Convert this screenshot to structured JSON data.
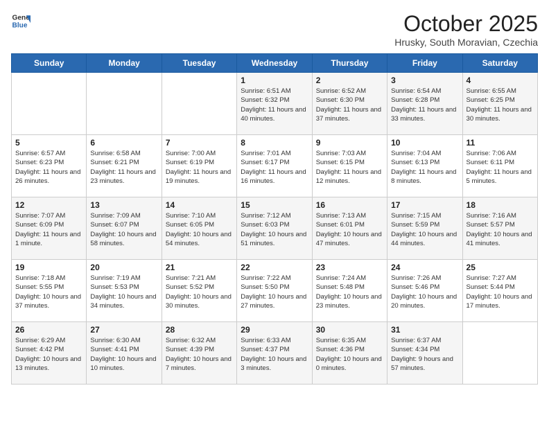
{
  "logo": {
    "line1": "General",
    "line2": "Blue"
  },
  "title": "October 2025",
  "subtitle": "Hrusky, South Moravian, Czechia",
  "weekdays": [
    "Sunday",
    "Monday",
    "Tuesday",
    "Wednesday",
    "Thursday",
    "Friday",
    "Saturday"
  ],
  "weeks": [
    [
      {
        "day": "",
        "sunrise": "",
        "sunset": "",
        "daylight": ""
      },
      {
        "day": "",
        "sunrise": "",
        "sunset": "",
        "daylight": ""
      },
      {
        "day": "",
        "sunrise": "",
        "sunset": "",
        "daylight": ""
      },
      {
        "day": "1",
        "sunrise": "Sunrise: 6:51 AM",
        "sunset": "Sunset: 6:32 PM",
        "daylight": "Daylight: 11 hours and 40 minutes."
      },
      {
        "day": "2",
        "sunrise": "Sunrise: 6:52 AM",
        "sunset": "Sunset: 6:30 PM",
        "daylight": "Daylight: 11 hours and 37 minutes."
      },
      {
        "day": "3",
        "sunrise": "Sunrise: 6:54 AM",
        "sunset": "Sunset: 6:28 PM",
        "daylight": "Daylight: 11 hours and 33 minutes."
      },
      {
        "day": "4",
        "sunrise": "Sunrise: 6:55 AM",
        "sunset": "Sunset: 6:25 PM",
        "daylight": "Daylight: 11 hours and 30 minutes."
      }
    ],
    [
      {
        "day": "5",
        "sunrise": "Sunrise: 6:57 AM",
        "sunset": "Sunset: 6:23 PM",
        "daylight": "Daylight: 11 hours and 26 minutes."
      },
      {
        "day": "6",
        "sunrise": "Sunrise: 6:58 AM",
        "sunset": "Sunset: 6:21 PM",
        "daylight": "Daylight: 11 hours and 23 minutes."
      },
      {
        "day": "7",
        "sunrise": "Sunrise: 7:00 AM",
        "sunset": "Sunset: 6:19 PM",
        "daylight": "Daylight: 11 hours and 19 minutes."
      },
      {
        "day": "8",
        "sunrise": "Sunrise: 7:01 AM",
        "sunset": "Sunset: 6:17 PM",
        "daylight": "Daylight: 11 hours and 16 minutes."
      },
      {
        "day": "9",
        "sunrise": "Sunrise: 7:03 AM",
        "sunset": "Sunset: 6:15 PM",
        "daylight": "Daylight: 11 hours and 12 minutes."
      },
      {
        "day": "10",
        "sunrise": "Sunrise: 7:04 AM",
        "sunset": "Sunset: 6:13 PM",
        "daylight": "Daylight: 11 hours and 8 minutes."
      },
      {
        "day": "11",
        "sunrise": "Sunrise: 7:06 AM",
        "sunset": "Sunset: 6:11 PM",
        "daylight": "Daylight: 11 hours and 5 minutes."
      }
    ],
    [
      {
        "day": "12",
        "sunrise": "Sunrise: 7:07 AM",
        "sunset": "Sunset: 6:09 PM",
        "daylight": "Daylight: 11 hours and 1 minute."
      },
      {
        "day": "13",
        "sunrise": "Sunrise: 7:09 AM",
        "sunset": "Sunset: 6:07 PM",
        "daylight": "Daylight: 10 hours and 58 minutes."
      },
      {
        "day": "14",
        "sunrise": "Sunrise: 7:10 AM",
        "sunset": "Sunset: 6:05 PM",
        "daylight": "Daylight: 10 hours and 54 minutes."
      },
      {
        "day": "15",
        "sunrise": "Sunrise: 7:12 AM",
        "sunset": "Sunset: 6:03 PM",
        "daylight": "Daylight: 10 hours and 51 minutes."
      },
      {
        "day": "16",
        "sunrise": "Sunrise: 7:13 AM",
        "sunset": "Sunset: 6:01 PM",
        "daylight": "Daylight: 10 hours and 47 minutes."
      },
      {
        "day": "17",
        "sunrise": "Sunrise: 7:15 AM",
        "sunset": "Sunset: 5:59 PM",
        "daylight": "Daylight: 10 hours and 44 minutes."
      },
      {
        "day": "18",
        "sunrise": "Sunrise: 7:16 AM",
        "sunset": "Sunset: 5:57 PM",
        "daylight": "Daylight: 10 hours and 41 minutes."
      }
    ],
    [
      {
        "day": "19",
        "sunrise": "Sunrise: 7:18 AM",
        "sunset": "Sunset: 5:55 PM",
        "daylight": "Daylight: 10 hours and 37 minutes."
      },
      {
        "day": "20",
        "sunrise": "Sunrise: 7:19 AM",
        "sunset": "Sunset: 5:53 PM",
        "daylight": "Daylight: 10 hours and 34 minutes."
      },
      {
        "day": "21",
        "sunrise": "Sunrise: 7:21 AM",
        "sunset": "Sunset: 5:52 PM",
        "daylight": "Daylight: 10 hours and 30 minutes."
      },
      {
        "day": "22",
        "sunrise": "Sunrise: 7:22 AM",
        "sunset": "Sunset: 5:50 PM",
        "daylight": "Daylight: 10 hours and 27 minutes."
      },
      {
        "day": "23",
        "sunrise": "Sunrise: 7:24 AM",
        "sunset": "Sunset: 5:48 PM",
        "daylight": "Daylight: 10 hours and 23 minutes."
      },
      {
        "day": "24",
        "sunrise": "Sunrise: 7:26 AM",
        "sunset": "Sunset: 5:46 PM",
        "daylight": "Daylight: 10 hours and 20 minutes."
      },
      {
        "day": "25",
        "sunrise": "Sunrise: 7:27 AM",
        "sunset": "Sunset: 5:44 PM",
        "daylight": "Daylight: 10 hours and 17 minutes."
      }
    ],
    [
      {
        "day": "26",
        "sunrise": "Sunrise: 6:29 AM",
        "sunset": "Sunset: 4:42 PM",
        "daylight": "Daylight: 10 hours and 13 minutes."
      },
      {
        "day": "27",
        "sunrise": "Sunrise: 6:30 AM",
        "sunset": "Sunset: 4:41 PM",
        "daylight": "Daylight: 10 hours and 10 minutes."
      },
      {
        "day": "28",
        "sunrise": "Sunrise: 6:32 AM",
        "sunset": "Sunset: 4:39 PM",
        "daylight": "Daylight: 10 hours and 7 minutes."
      },
      {
        "day": "29",
        "sunrise": "Sunrise: 6:33 AM",
        "sunset": "Sunset: 4:37 PM",
        "daylight": "Daylight: 10 hours and 3 minutes."
      },
      {
        "day": "30",
        "sunrise": "Sunrise: 6:35 AM",
        "sunset": "Sunset: 4:36 PM",
        "daylight": "Daylight: 10 hours and 0 minutes."
      },
      {
        "day": "31",
        "sunrise": "Sunrise: 6:37 AM",
        "sunset": "Sunset: 4:34 PM",
        "daylight": "Daylight: 9 hours and 57 minutes."
      },
      {
        "day": "",
        "sunrise": "",
        "sunset": "",
        "daylight": ""
      }
    ]
  ]
}
